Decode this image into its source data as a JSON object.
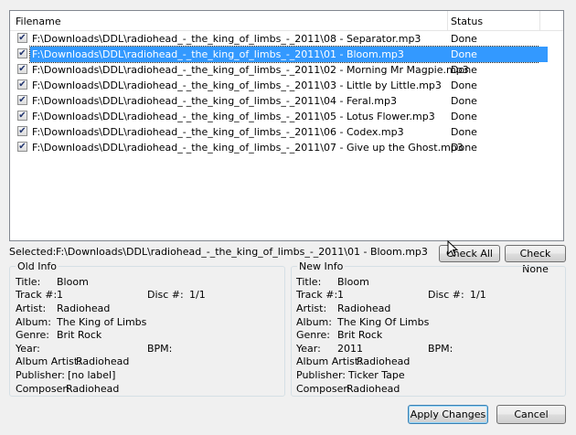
{
  "file_list": {
    "columns": {
      "filename": "Filename",
      "status": "Status"
    },
    "rows": [
      {
        "checked": true,
        "filename": "F:\\Downloads\\DDL\\radiohead_-_the_king_of_limbs_-_2011\\08 - Separator.mp3",
        "status": "Done",
        "selected": false
      },
      {
        "checked": true,
        "filename": "F:\\Downloads\\DDL\\radiohead_-_the_king_of_limbs_-_2011\\01 - Bloom.mp3",
        "status": "Done",
        "selected": true
      },
      {
        "checked": true,
        "filename": "F:\\Downloads\\DDL\\radiohead_-_the_king_of_limbs_-_2011\\02 - Morning Mr Magpie.mp3",
        "status": "Done",
        "selected": false
      },
      {
        "checked": true,
        "filename": "F:\\Downloads\\DDL\\radiohead_-_the_king_of_limbs_-_2011\\03 - Little by Little.mp3",
        "status": "Done",
        "selected": false
      },
      {
        "checked": true,
        "filename": "F:\\Downloads\\DDL\\radiohead_-_the_king_of_limbs_-_2011\\04 - Feral.mp3",
        "status": "Done",
        "selected": false
      },
      {
        "checked": true,
        "filename": "F:\\Downloads\\DDL\\radiohead_-_the_king_of_limbs_-_2011\\05 - Lotus Flower.mp3",
        "status": "Done",
        "selected": false
      },
      {
        "checked": true,
        "filename": "F:\\Downloads\\DDL\\radiohead_-_the_king_of_limbs_-_2011\\06 - Codex.mp3",
        "status": "Done",
        "selected": false
      },
      {
        "checked": true,
        "filename": "F:\\Downloads\\DDL\\radiohead_-_the_king_of_limbs_-_2011\\07 - Give up the Ghost.mp3",
        "status": "Done",
        "selected": false
      }
    ]
  },
  "selected_bar": {
    "label": "Selected:",
    "value": "F:\\Downloads\\DDL\\radiohead_-_the_king_of_limbs_-_2011\\01 - Bloom.mp3"
  },
  "buttons": {
    "check_all": "Check All",
    "check_none": "Check None",
    "apply": "Apply Changes",
    "cancel": "Cancel"
  },
  "labels": {
    "title": "Title:",
    "track": "Track #:",
    "disc": "Disc #:",
    "artist": "Artist:",
    "album": "Album:",
    "genre": "Genre:",
    "year": "Year:",
    "bpm": "BPM:",
    "album_artist": "Album Artist:",
    "publisher": "Publisher:",
    "composer": "Composer:"
  },
  "old_info": {
    "heading": "Old Info",
    "title": "Bloom",
    "track": "1",
    "disc": "1/1",
    "artist": "Radiohead",
    "album": "The King of Limbs",
    "genre": "Brit Rock",
    "year": "",
    "bpm": "",
    "album_artist": "Radiohead",
    "publisher": "[no label]",
    "composer": "Radiohead"
  },
  "new_info": {
    "heading": "New Info",
    "title": "Bloom",
    "track": "1",
    "disc": "1/1",
    "artist": "Radiohead",
    "album": "The King Of Limbs",
    "genre": "Brit Rock",
    "year": "2011",
    "bpm": "",
    "album_artist": "Radiohead",
    "publisher": "Ticker Tape",
    "composer": "Radiohead"
  }
}
